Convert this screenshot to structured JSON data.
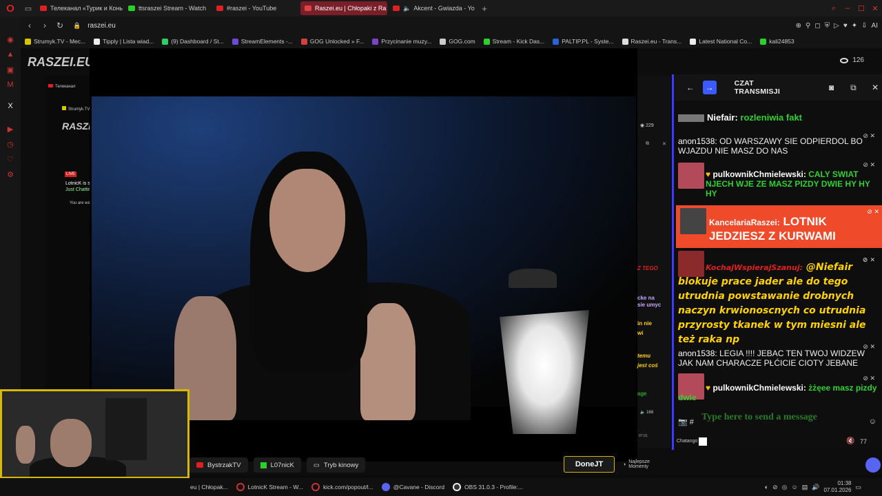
{
  "browser": {
    "tabs": [
      {
        "label": "Телеканал «Турик и Конь",
        "icon": "youtube-icon",
        "active": false
      },
      {
        "label": "ttsraszei Stream - Watch",
        "icon": "kick-icon",
        "active": false
      },
      {
        "label": "#raszei - YouTube",
        "icon": "youtube-icon",
        "active": false
      },
      {
        "label": "Raszei.eu | Chłopaki z Ra",
        "icon": "raszei-icon",
        "active": true
      },
      {
        "label": "Akcent - Gwiazda - Yo",
        "icon": "youtube-icon",
        "active": false
      }
    ],
    "url": "raszei.eu",
    "addr_right": "AI",
    "bookmarks": [
      {
        "label": "Strumyk.TV - Mec...",
        "color": "#d8c400"
      },
      {
        "label": "Tipply | Lista wiad...",
        "color": "#eeeeee"
      },
      {
        "label": "(9) Dashboard / St...",
        "color": "#33cc66"
      },
      {
        "label": "StreamElements -...",
        "color": "#6a4bd8"
      },
      {
        "label": "GOG Unlocked » F...",
        "color": "#d24040"
      },
      {
        "label": "Przycinanie muzy...",
        "color": "#7a44c9"
      },
      {
        "label": "GOG.com",
        "color": "#cccccc"
      },
      {
        "label": "Stream - Kick Das...",
        "color": "#2ad12a"
      },
      {
        "label": "PALTIP.PL - Syste...",
        "color": "#2a62d8"
      },
      {
        "label": "Raszei.eu - Trans...",
        "color": "#dddddd"
      },
      {
        "label": "Latest National Co...",
        "color": "#eeeeee"
      },
      {
        "label": "kali24853",
        "color": "#2ad12a"
      }
    ]
  },
  "page": {
    "logo": "RASZEI.EU",
    "viewers": "126"
  },
  "nested": {
    "tab1": "Телеканал",
    "bm1": "Strumyk.TV - Mec",
    "logo": "RASZEI.EU",
    "live": "LIVE",
    "title": "LotnicK is strea",
    "category": "Just Chatting",
    "watching": "You are watc"
  },
  "strip": {
    "viewers": "229",
    "txt_red": "Z TEGO",
    "txt1": "cke na",
    "txt2": "sie umyc",
    "txt3": "in nie",
    "txt4": "wi",
    "txt5": "temu",
    "txt6": "jest coś",
    "txt7": "age",
    "count": "168",
    "date": "07.01"
  },
  "chat": {
    "title": "CZAT TRANSMISJI",
    "messages": [
      {
        "nick": "Niefair:",
        "text": "rozleniwia fakt"
      },
      {
        "nick": "anon1538:",
        "text": "OD WARSZAWY SIE ODPIERDOL BO WJAZDU NIE MASZ DO NAS"
      },
      {
        "nick": "pulkownikChmielewski:",
        "text": "CALY SWIAT NJECH WJE ZE MASZ PIZDY DWIE HY HY HY"
      },
      {
        "nick": "KancelariaRaszei:",
        "text": "LOTNIK JEDZIESZ Z KURWAMI"
      },
      {
        "nick": "KochajWspierajSzanuj:",
        "text": "@Niefair blokuje prace jader ale do tego utrudnia powstawanie drobnych naczyn krwionoscnych co utrudnia przyrosty tkanek w tym miesni ale też raka np"
      },
      {
        "nick": "anon1538:",
        "text": "LEGIA !!!! JEBAC TEN TWOJ WIDZEW JAK NAM CHARACZE PŁĆICIE CIOTY JEBANE"
      },
      {
        "nick": "pulkownikChmielewski:",
        "text": "żżęee masz pizdy dwie"
      }
    ],
    "input_placeholder": "Type here to send a message",
    "footer_brand": "Chatango",
    "footer_count": "77"
  },
  "streambar": {
    "items": [
      "BystrzakTV",
      "L07nicK",
      "Tryb kinowy"
    ],
    "done": "DoneJT",
    "najlepsze": "Najlepsze Momenty"
  },
  "taskbar": {
    "items": [
      {
        "label": "eu | Chłopak...",
        "color": "#c33"
      },
      {
        "label": "LotnicK Stream - W...",
        "color": "#c33"
      },
      {
        "label": "kick.com/popout/l...",
        "color": "#c33"
      },
      {
        "label": "@Cavane - Discord",
        "color": "#5865f2"
      },
      {
        "label": "OBS 31.0.3 - Profile:...",
        "color": "#222"
      }
    ],
    "time": "01:38",
    "date": "07.01.2026"
  }
}
